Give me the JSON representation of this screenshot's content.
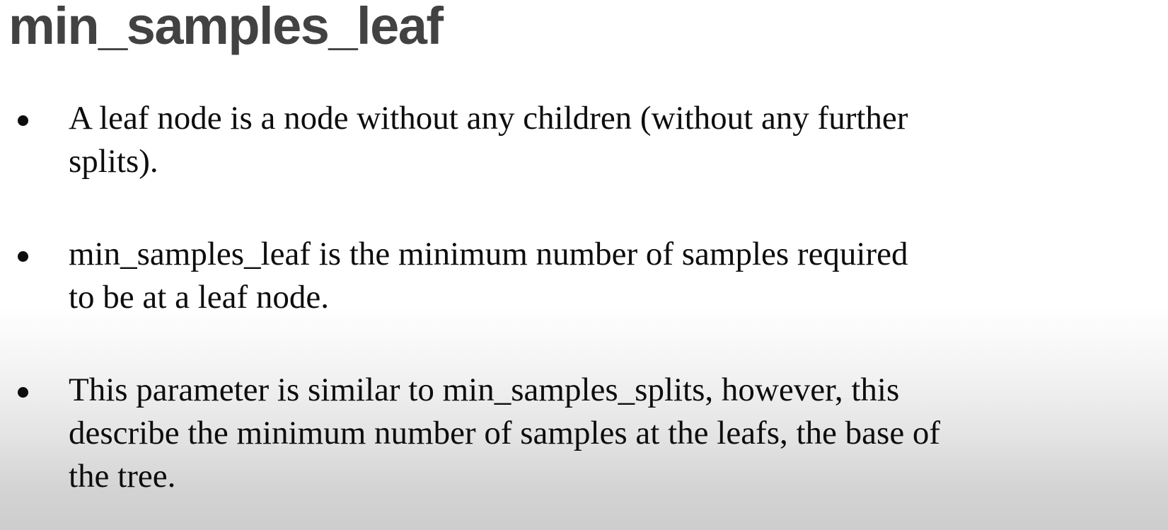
{
  "slide": {
    "title": "min_samples_leaf",
    "bullets": [
      "A leaf node is a node without any children (without any further\nsplits).",
      "min_samples_leaf is the minimum number of samples required\nto be at a leaf node.",
      "This parameter is similar to min_samples_splits, however, this\ndescribe the minimum number of samples at the leafs, the base of\nthe tree."
    ]
  },
  "colors": {
    "title": "#424242",
    "body_text": "#0d0d0d",
    "background_top": "#ffffff",
    "background_bottom": "#cdcdcd"
  }
}
